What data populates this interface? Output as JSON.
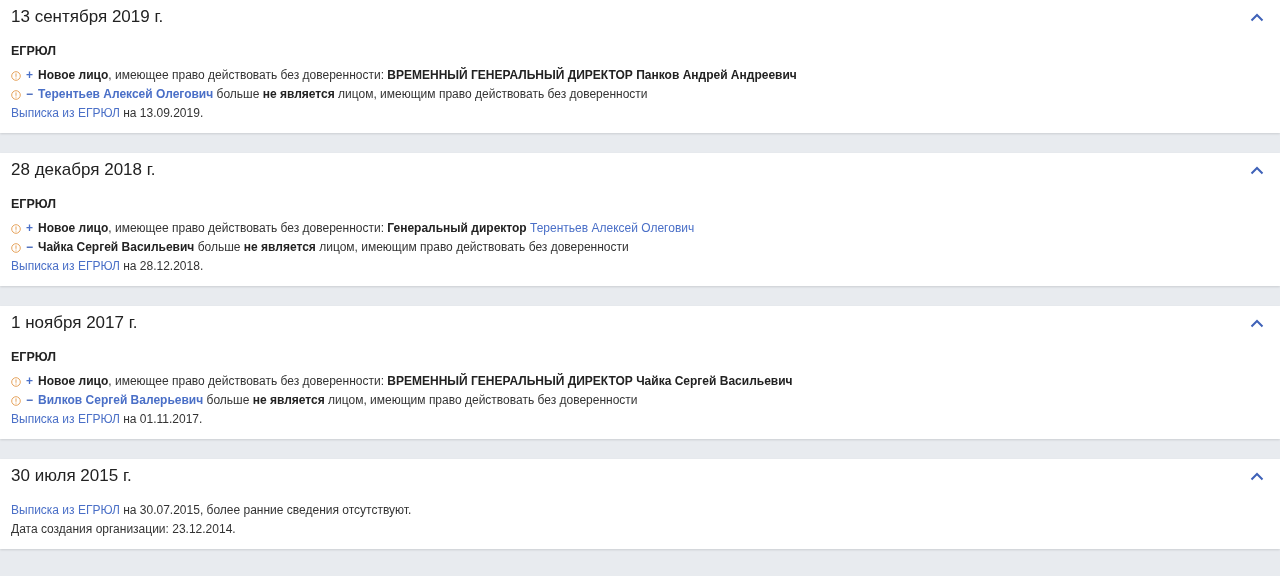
{
  "events": [
    {
      "date": "13 сентября 2019 г.",
      "expanded": true,
      "source": "ЕГРЮЛ",
      "changes": [
        {
          "kind": "added",
          "sign": "+",
          "parts": [
            {
              "kind": "bold",
              "text": "Новое лицо"
            },
            {
              "kind": "plain",
              "text": ", имеющее право действовать без доверенности: "
            },
            {
              "kind": "bold",
              "text": "ВРЕМЕННЫЙ ГЕНЕРАЛЬНЫЙ ДИРЕКТОР Панков Андрей Андреевич"
            }
          ]
        },
        {
          "kind": "removed",
          "sign": "−",
          "parts": [
            {
              "kind": "boldlink",
              "text": "Терентьев Алексей Олегович"
            },
            {
              "kind": "plain",
              "text": " больше "
            },
            {
              "kind": "bold",
              "text": "не является"
            },
            {
              "kind": "plain",
              "text": " лицом, имеющим право действовать без доверенности"
            }
          ]
        }
      ],
      "notes": [
        [
          {
            "kind": "link",
            "text": "Выписка из ЕГРЮЛ"
          },
          {
            "kind": "plain",
            "text": " на 13.09.2019."
          }
        ]
      ]
    },
    {
      "date": "28 декабря 2018 г.",
      "expanded": true,
      "source": "ЕГРЮЛ",
      "changes": [
        {
          "kind": "added",
          "sign": "+",
          "parts": [
            {
              "kind": "bold",
              "text": "Новое лицо"
            },
            {
              "kind": "plain",
              "text": ", имеющее право действовать без доверенности: "
            },
            {
              "kind": "bold",
              "text": "Генеральный директор "
            },
            {
              "kind": "link",
              "text": "Терентьев Алексей Олегович"
            }
          ]
        },
        {
          "kind": "removed",
          "sign": "−",
          "parts": [
            {
              "kind": "bold",
              "text": "Чайка Сергей Васильевич"
            },
            {
              "kind": "plain",
              "text": " больше "
            },
            {
              "kind": "bold",
              "text": "не является"
            },
            {
              "kind": "plain",
              "text": " лицом, имеющим право действовать без доверенности"
            }
          ]
        }
      ],
      "notes": [
        [
          {
            "kind": "link",
            "text": "Выписка из ЕГРЮЛ"
          },
          {
            "kind": "plain",
            "text": " на 28.12.2018."
          }
        ]
      ]
    },
    {
      "date": "1 ноября 2017 г.",
      "expanded": true,
      "source": "ЕГРЮЛ",
      "changes": [
        {
          "kind": "added",
          "sign": "+",
          "parts": [
            {
              "kind": "bold",
              "text": "Новое лицо"
            },
            {
              "kind": "plain",
              "text": ", имеющее право действовать без доверенности: "
            },
            {
              "kind": "bold",
              "text": "ВРЕМЕННЫЙ ГЕНЕРАЛЬНЫЙ ДИРЕКТОР Чайка Сергей Васильевич"
            }
          ]
        },
        {
          "kind": "removed",
          "sign": "−",
          "parts": [
            {
              "kind": "boldlink",
              "text": "Вилков Сергей Валерьевич"
            },
            {
              "kind": "plain",
              "text": " больше "
            },
            {
              "kind": "bold",
              "text": "не является"
            },
            {
              "kind": "plain",
              "text": " лицом, имеющим право действовать без доверенности"
            }
          ]
        }
      ],
      "notes": [
        [
          {
            "kind": "link",
            "text": "Выписка из ЕГРЮЛ"
          },
          {
            "kind": "plain",
            "text": " на 01.11.2017."
          }
        ]
      ]
    },
    {
      "date": "30 июля 2015 г.",
      "expanded": true,
      "notes": [
        [
          {
            "kind": "link",
            "text": "Выписка из ЕГРЮЛ"
          },
          {
            "kind": "plain",
            "text": " на 30.07.2015, более ранние сведения отсутствуют."
          }
        ],
        [
          {
            "kind": "plain",
            "text": "Дата создания организации: 23.12.2014."
          }
        ]
      ]
    }
  ]
}
